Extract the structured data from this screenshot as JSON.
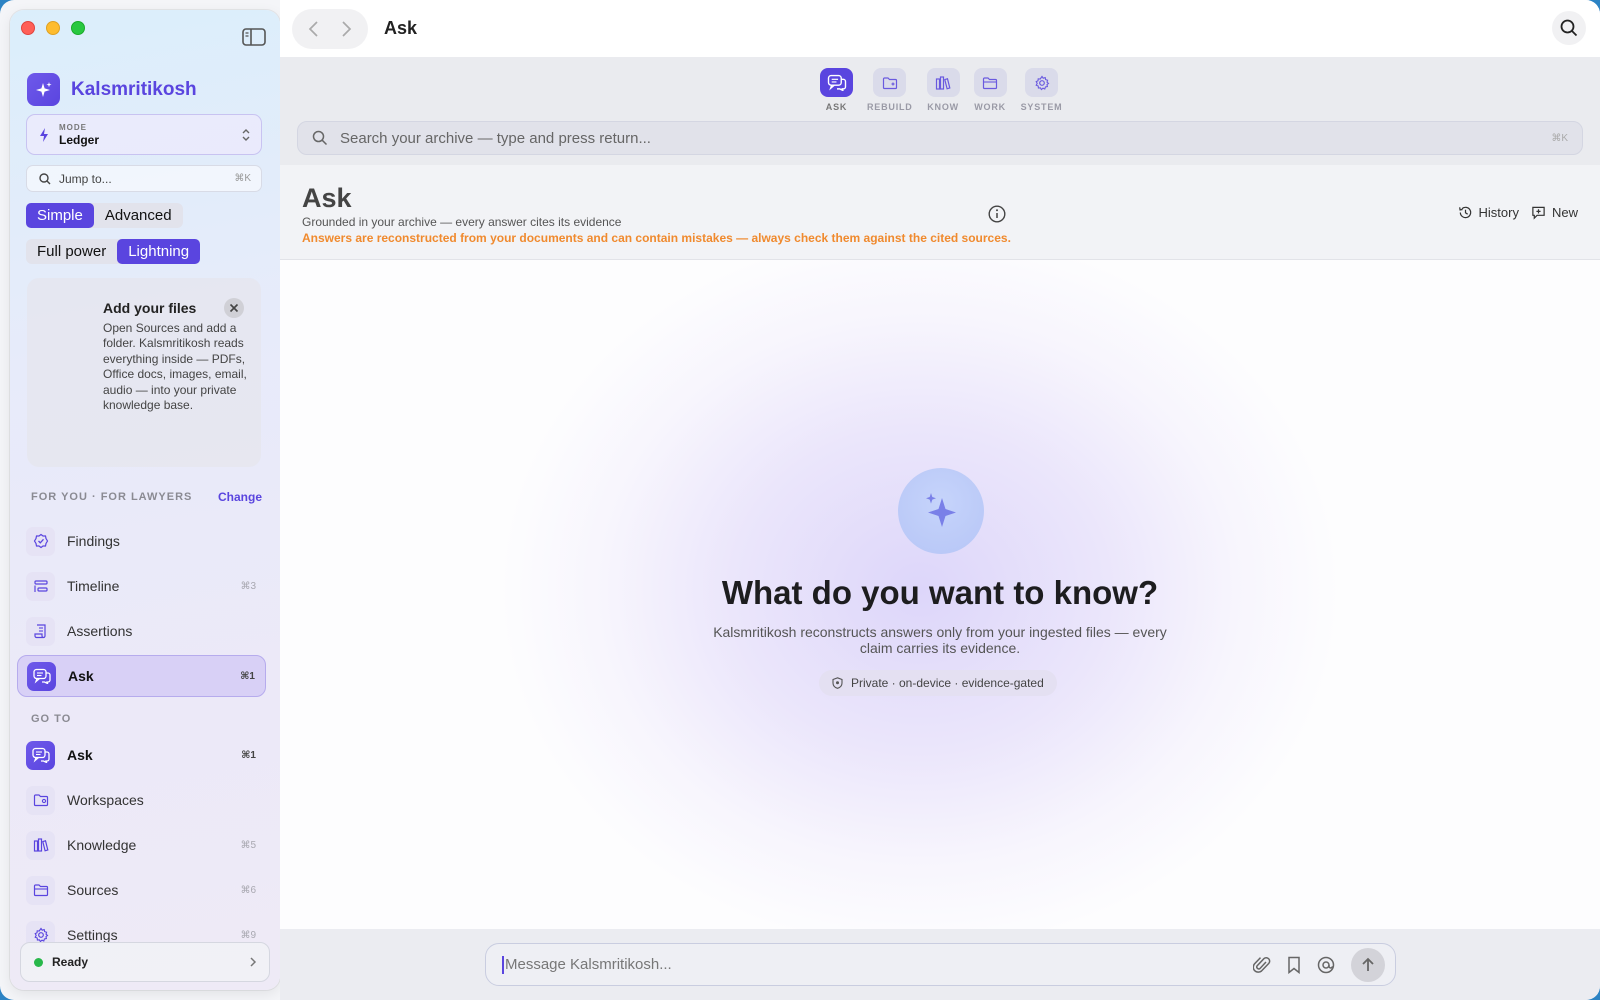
{
  "window": {
    "title": "Ask"
  },
  "brand": {
    "name": "Kalsmritikosh"
  },
  "mode": {
    "label": "MODE",
    "value": "Ledger"
  },
  "jump": {
    "placeholder": "Jump to...",
    "shortcut": "⌘K"
  },
  "segments": {
    "complexity": [
      {
        "label": "Simple",
        "active": true
      },
      {
        "label": "Advanced",
        "active": false
      }
    ],
    "power": [
      {
        "label": "Full power",
        "active": false
      },
      {
        "label": "Lightning",
        "active": true
      }
    ]
  },
  "tip": {
    "title": "Add your files",
    "body": "Open Sources and add a folder. Kalsmritikosh reads everything inside — PDFs, Office docs, images, email, audio — into your private knowledge base."
  },
  "for_you": {
    "heading": "FOR YOU · FOR LAWYERS",
    "change_label": "Change",
    "items": [
      {
        "label": "Findings",
        "icon": "findings-badge-icon",
        "shortcut": ""
      },
      {
        "label": "Timeline",
        "icon": "timeline-icon",
        "shortcut": "⌘3"
      },
      {
        "label": "Assertions",
        "icon": "scroll-icon",
        "shortcut": ""
      },
      {
        "label": "Ask",
        "icon": "chat-bubbles-icon",
        "shortcut": "⌘1",
        "active": true
      }
    ]
  },
  "go_to": {
    "heading": "GO TO",
    "items": [
      {
        "label": "Ask",
        "icon": "chat-bubbles-icon",
        "shortcut": "⌘1"
      },
      {
        "label": "Workspaces",
        "icon": "folder-gear-icon",
        "shortcut": ""
      },
      {
        "label": "Knowledge",
        "icon": "books-icon",
        "shortcut": "⌘5"
      },
      {
        "label": "Sources",
        "icon": "folder-icon",
        "shortcut": "⌘6"
      },
      {
        "label": "Settings",
        "icon": "gear-icon",
        "shortcut": "⌘9"
      }
    ]
  },
  "status": {
    "label": "Ready",
    "color": "#28b84a"
  },
  "tabs": [
    {
      "label": "ASK",
      "icon": "chat-bubbles-icon",
      "active": true
    },
    {
      "label": "REBUILD",
      "icon": "folder-plus-icon",
      "active": false
    },
    {
      "label": "KNOW",
      "icon": "books-icon",
      "active": false
    },
    {
      "label": "WORK",
      "icon": "folder-icon",
      "active": false
    },
    {
      "label": "SYSTEM",
      "icon": "gear-icon",
      "active": false
    }
  ],
  "archive_search": {
    "placeholder": "Search your archive — type and press return...",
    "shortcut": "⌘K"
  },
  "ask": {
    "title": "Ask",
    "subtitle": "Grounded in your archive — every answer cites its evidence",
    "warning": "Answers are reconstructed from your documents and can contain mistakes — always check them against the cited sources.",
    "history_label": "History",
    "new_label": "New"
  },
  "hero": {
    "title": "What do you want to know?",
    "subtitle": "Kalsmritikosh reconstructs answers only from your ingested files — every claim carries its evidence.",
    "pill": "Private · on-device · evidence-gated"
  },
  "composer": {
    "placeholder": "Message Kalsmritikosh..."
  },
  "colors": {
    "accent": "#5a45df",
    "warning": "#f08a2e",
    "status_ok": "#28b84a"
  }
}
